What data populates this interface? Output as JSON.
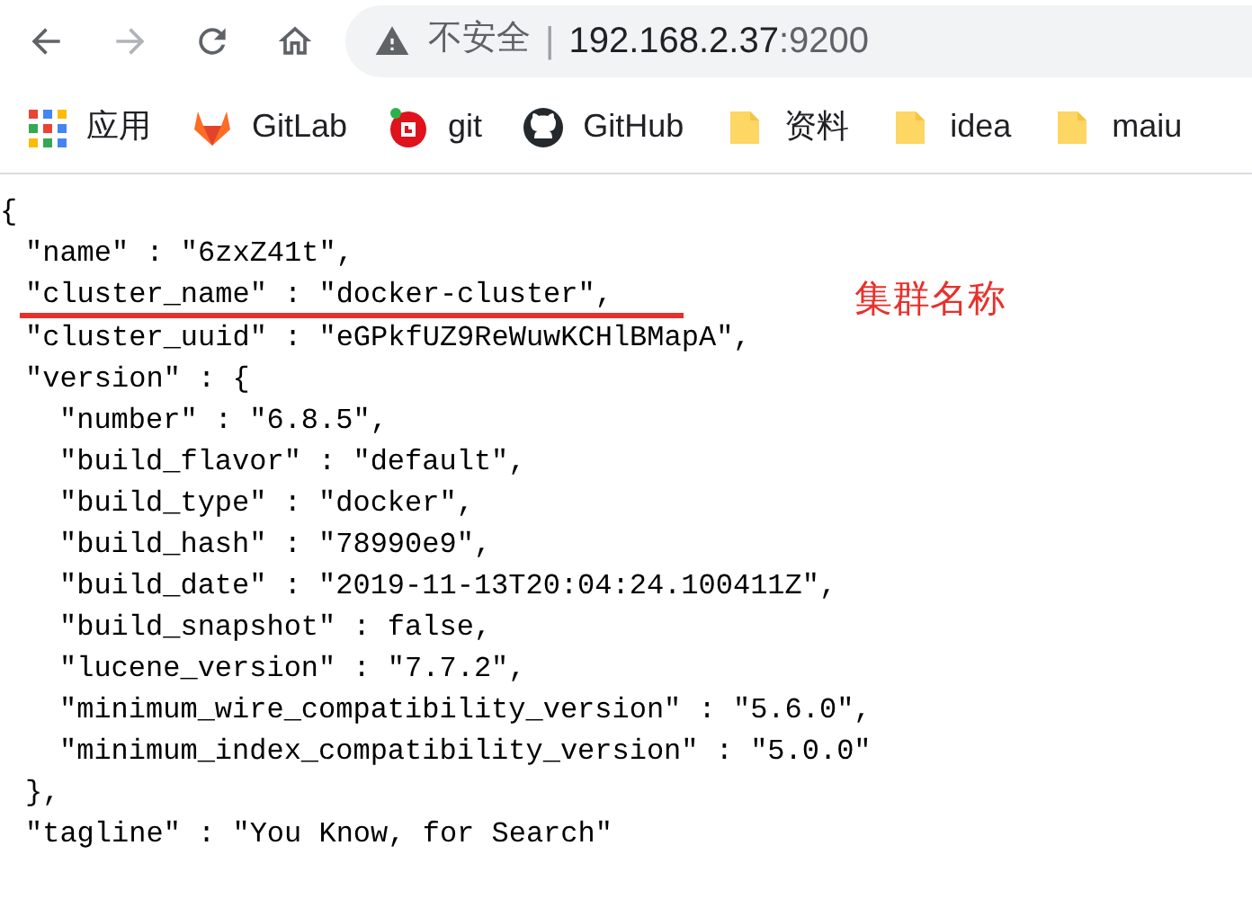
{
  "toolbar": {
    "nav_buttons": [
      {
        "kind": "back",
        "disabled": false
      },
      {
        "kind": "forward",
        "disabled": true
      },
      {
        "kind": "reload",
        "disabled": false
      },
      {
        "kind": "home",
        "disabled": false
      }
    ],
    "address_bar": {
      "security": "不安全",
      "separator": "|",
      "host": "192.168.2.37",
      "port": ":9200"
    }
  },
  "bookmarks": [
    {
      "kind": "apps",
      "label": "应用"
    },
    {
      "kind": "gitlab",
      "label": "GitLab"
    },
    {
      "kind": "git",
      "label": "git"
    },
    {
      "kind": "github",
      "label": "GitHub"
    },
    {
      "kind": "folder",
      "label": "资料"
    },
    {
      "kind": "folder",
      "label": "idea"
    },
    {
      "kind": "folder",
      "label": "maiu"
    }
  ],
  "json_lines": [
    {
      "text": "{",
      "children": [
        {
          "text": "\"name\" : \"6zxZ41t\","
        },
        {
          "text": "\"cluster_name\" : \"docker-cluster\",",
          "underlined": true
        },
        {
          "text": "\"cluster_uuid\" : \"eGPkfUZ9ReWuwKCHlBMapA\","
        },
        {
          "text": "\"version\" : {",
          "children": [
            {
              "text": "\"number\" : \"6.8.5\","
            },
            {
              "text": "\"build_flavor\" : \"default\","
            },
            {
              "text": "\"build_type\" : \"docker\","
            },
            {
              "text": "\"build_hash\" : \"78990e9\","
            },
            {
              "text": "\"build_date\" : \"2019-11-13T20:04:24.100411Z\","
            },
            {
              "text": "\"build_snapshot\" : false,"
            },
            {
              "text": "\"lucene_version\" : \"7.7.2\","
            },
            {
              "text": "\"minimum_wire_compatibility_version\" : \"5.6.0\","
            },
            {
              "text": "\"minimum_index_compatibility_version\" : \"5.0.0\""
            }
          ]
        },
        {
          "text": "},"
        },
        {
          "text": "\"tagline\" : \"You Know, for Search\""
        }
      ]
    }
  ],
  "annotation": {
    "text": "集群名称"
  }
}
